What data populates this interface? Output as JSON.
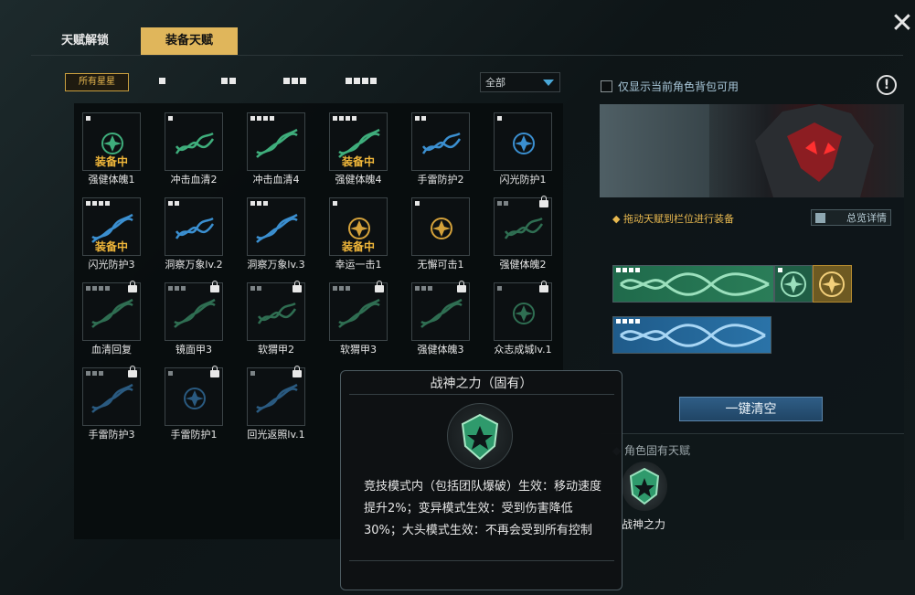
{
  "tabs": {
    "unlock": "天赋解锁",
    "equip": "装备天赋"
  },
  "close_icon": "✕",
  "filters": {
    "all_ranks": "所有星星",
    "dropdown_value": "全部"
  },
  "options": {
    "show_only_bag": "仅显示当前角色背包可用"
  },
  "equipped_label": "装备中",
  "talents": [
    {
      "name": "强健体魄1",
      "pips": 1,
      "color": "#3fae7c",
      "shape": "emblem",
      "equipped": true,
      "locked": false
    },
    {
      "name": "冲击血清2",
      "pips": 1,
      "color": "#3fae7c",
      "shape": "dna1",
      "equipped": false,
      "locked": false
    },
    {
      "name": "冲击血清4",
      "pips": 4,
      "color": "#3fae7c",
      "shape": "dna2",
      "equipped": false,
      "locked": false
    },
    {
      "name": "强健体魄4",
      "pips": 4,
      "color": "#3fae7c",
      "shape": "dna2",
      "equipped": true,
      "locked": false
    },
    {
      "name": "手雷防护2",
      "pips": 2,
      "color": "#3b8fd0",
      "shape": "dna1",
      "equipped": false,
      "locked": false
    },
    {
      "name": "闪光防护1",
      "pips": 1,
      "color": "#3b8fd0",
      "shape": "emblem",
      "equipped": false,
      "locked": false
    },
    {
      "name": "闪光防护3",
      "pips": 4,
      "color": "#3b8fd0",
      "shape": "dna2",
      "equipped": true,
      "locked": false
    },
    {
      "name": "洞察万象lv.2",
      "pips": 2,
      "color": "#3b8fd0",
      "shape": "dna1",
      "equipped": false,
      "locked": false
    },
    {
      "name": "洞察万象lv.3",
      "pips": 3,
      "color": "#3b8fd0",
      "shape": "dna2",
      "equipped": false,
      "locked": false
    },
    {
      "name": "幸运一击1",
      "pips": 1,
      "color": "#d4a13a",
      "shape": "emblem",
      "equipped": true,
      "locked": false
    },
    {
      "name": "无懈可击1",
      "pips": 1,
      "color": "#d4a13a",
      "shape": "emblem",
      "equipped": false,
      "locked": false
    },
    {
      "name": "强健体魄2",
      "pips": 2,
      "color": "#2f6e52",
      "shape": "dna1",
      "equipped": false,
      "locked": true
    },
    {
      "name": "血清回复",
      "pips": 4,
      "color": "#2f6e52",
      "shape": "dna2",
      "equipped": false,
      "locked": true
    },
    {
      "name": "镜面甲3",
      "pips": 3,
      "color": "#2f6e52",
      "shape": "dna2",
      "equipped": false,
      "locked": true
    },
    {
      "name": "软猬甲2",
      "pips": 2,
      "color": "#2f6e52",
      "shape": "dna1",
      "equipped": false,
      "locked": true
    },
    {
      "name": "软猬甲3",
      "pips": 3,
      "color": "#2f6e52",
      "shape": "dna2",
      "equipped": false,
      "locked": true
    },
    {
      "name": "强健体魄3",
      "pips": 3,
      "color": "#2f6e52",
      "shape": "dna2",
      "equipped": false,
      "locked": true
    },
    {
      "name": "众志成城lv.1",
      "pips": 1,
      "color": "#2f6e52",
      "shape": "emblem",
      "equipped": false,
      "locked": true
    },
    {
      "name": "手雷防护3",
      "pips": 3,
      "color": "#2a5a80",
      "shape": "dna2",
      "equipped": false,
      "locked": true
    },
    {
      "name": "手雷防护1",
      "pips": 1,
      "color": "#2a5a80",
      "shape": "emblem",
      "equipped": false,
      "locked": true
    },
    {
      "name": "回光返照lv.1",
      "pips": 1,
      "color": "#2a5a80",
      "shape": "dna2",
      "equipped": false,
      "locked": true
    }
  ],
  "right": {
    "drag_hint": "拖动天赋到栏位进行装备",
    "detail_button": "总览详情",
    "clear_button": "一键清空",
    "innate_title": "角色固有天赋",
    "innate_name": "战神之力"
  },
  "tooltip": {
    "title": "战神之力（固有）",
    "desc": "竞技模式内（包括团队爆破）生效：移动速度提升2%；变异模式生效：受到伤害降低30%；大头模式生效：不再会受到所有控制"
  },
  "colors": {
    "accent_gold": "#e0b65b",
    "green": "#3fae7c",
    "blue": "#3b8fd0",
    "gold": "#d4a13a"
  }
}
